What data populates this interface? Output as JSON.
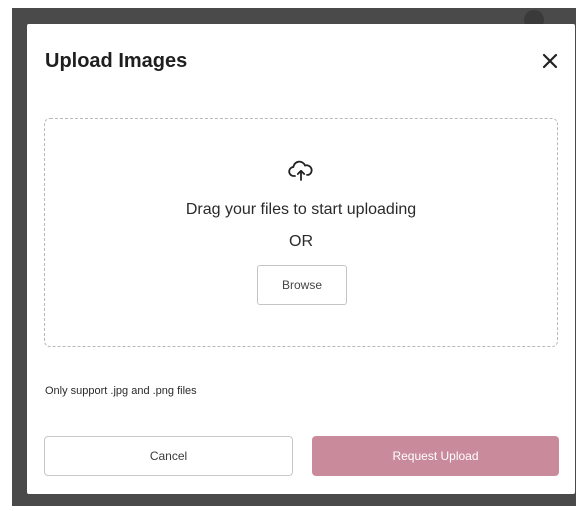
{
  "modal": {
    "title": "Upload Images",
    "close_icon": "close-icon"
  },
  "dropzone": {
    "icon": "cloud-upload-icon",
    "instruction": "Drag your files to start uploading",
    "separator": "OR",
    "browse_label": "Browse"
  },
  "note": "Only support .jpg and .png files",
  "actions": {
    "cancel_label": "Cancel",
    "request_label": "Request Upload"
  },
  "colors": {
    "primary_disabled": "#c98a9b",
    "backdrop": "#4a4a4a"
  }
}
